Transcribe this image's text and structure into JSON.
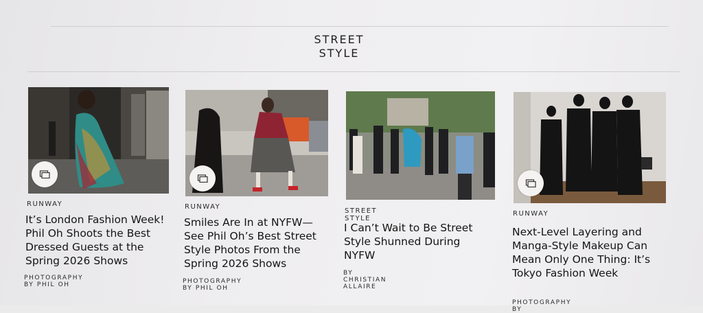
{
  "section": {
    "title_line1": "STREET",
    "title_line2": "STYLE"
  },
  "articles": [
    {
      "kicker": "RUNWAY",
      "headline": "It’s London Fashion Week! Phil Oh Shoots the Best Dressed Guests at the Spring 2026 Shows",
      "byline": "PHOTOGRAPHY BY PHIL OH",
      "image_icon": "gallery-icon"
    },
    {
      "kicker": "RUNWAY",
      "headline": "Smiles Are In at NYFW—See Phil Oh’s Best Street Style Photos From the Spring 2026 Shows",
      "byline": "PHOTOGRAPHY BY PHIL OH",
      "image_icon": "gallery-icon"
    },
    {
      "kicker": "STREET STYLE",
      "headline": "I Can’t Wait to Be Street Style Shunned During NYFW",
      "byline": "BY CHRISTIAN ALLAIRE"
    },
    {
      "kicker": "RUNWAY",
      "headline": "Next-Level Layering and Manga-Style Makeup Can Mean Only One Thing: It’s Tokyo Fashion Week",
      "byline": "PHOTOGRAPHY BY",
      "image_icon": "gallery-icon"
    }
  ]
}
